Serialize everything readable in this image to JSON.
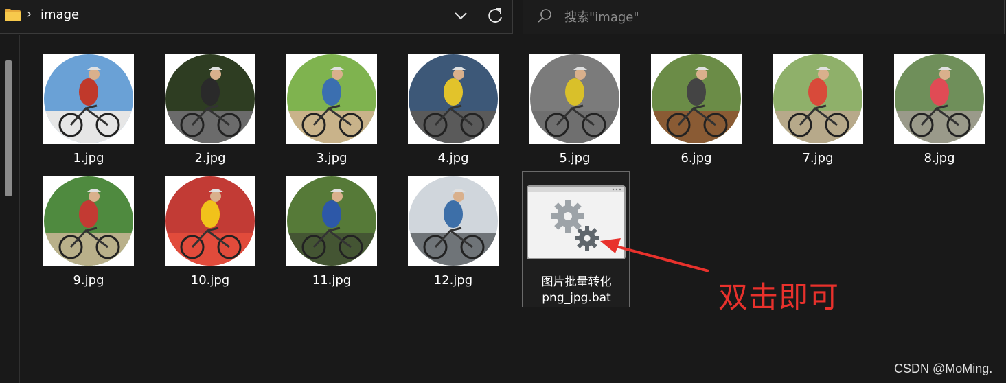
{
  "address_bar": {
    "path_segment": "image",
    "icons": {
      "folder": "folder-icon",
      "separator": "chevron-right-icon",
      "dropdown": "chevron-down-icon",
      "refresh": "refresh-icon"
    }
  },
  "search": {
    "placeholder": "搜索\"image\"",
    "value": "",
    "icon": "search-icon"
  },
  "files": [
    {
      "name": "1.jpg",
      "bg": "#6aa1d6",
      "fg": "#c0392b",
      "ground": "#e6e6e6"
    },
    {
      "name": "2.jpg",
      "bg": "#2e3d22",
      "fg": "#2a2a2a",
      "ground": "#6b6b6b"
    },
    {
      "name": "3.jpg",
      "bg": "#7fb34f",
      "fg": "#3b6fb0",
      "ground": "#c9b38a"
    },
    {
      "name": "4.jpg",
      "bg": "#3d5878",
      "fg": "#e2c32b",
      "ground": "#5a5a5a"
    },
    {
      "name": "5.jpg",
      "bg": "#7b7b7b",
      "fg": "#d9c02a",
      "ground": "#6f6f6f"
    },
    {
      "name": "6.jpg",
      "bg": "#6b8c47",
      "fg": "#444444",
      "ground": "#8a5b34"
    },
    {
      "name": "7.jpg",
      "bg": "#8fb06a",
      "fg": "#d84a3a",
      "ground": "#b7a98a"
    },
    {
      "name": "8.jpg",
      "bg": "#6f8f5a",
      "fg": "#e04b55",
      "ground": "#9a9a8a"
    },
    {
      "name": "9.jpg",
      "bg": "#4f8a3f",
      "fg": "#c33a33",
      "ground": "#b9b08a"
    },
    {
      "name": "10.jpg",
      "bg": "#c23b35",
      "fg": "#f1c21b",
      "ground": "#e14b3b"
    },
    {
      "name": "11.jpg",
      "bg": "#567a38",
      "fg": "#2d58a8",
      "ground": "#445533"
    },
    {
      "name": "12.jpg",
      "bg": "#d0d6dc",
      "fg": "#3d6fa8",
      "ground": "#6f7478"
    }
  ],
  "bat_file": {
    "line1": "图片批量转化",
    "line2": "png_jpg.bat",
    "icon": "settings-gears-icon"
  },
  "annotation": {
    "text": "双击即可",
    "color": "#e8312c",
    "arrow_icon": "red-arrow-icon"
  },
  "watermark": "CSDN @MoMing."
}
